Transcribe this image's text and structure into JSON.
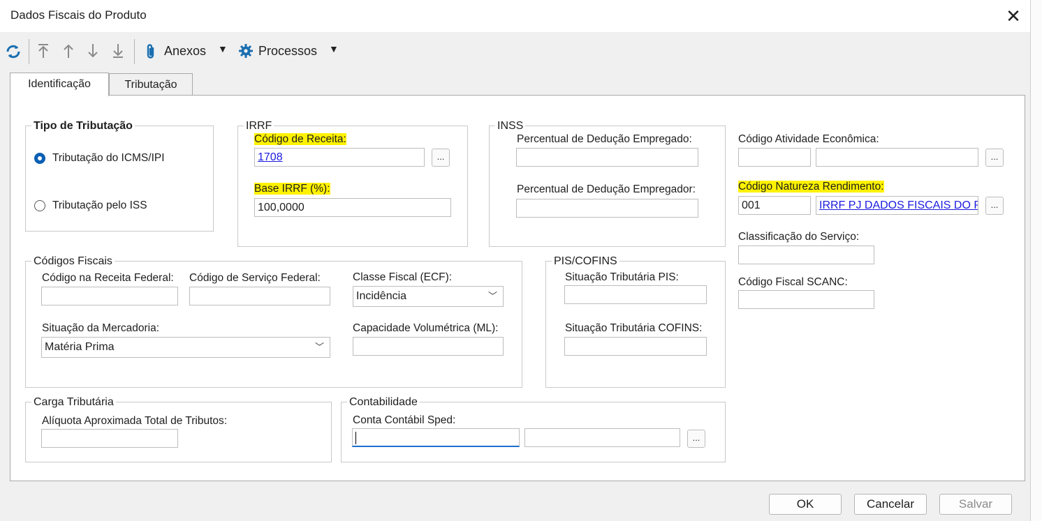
{
  "window": {
    "title": "Dados Fiscais do Produto",
    "close_glyph": "✕"
  },
  "toolbar": {
    "icons": [
      "refresh-icon",
      "move-first-icon",
      "move-up-icon",
      "move-down-icon",
      "move-last-icon"
    ],
    "anexos_label": "Anexos",
    "processos_label": "Processos"
  },
  "tabs": [
    {
      "label": "Identificação",
      "active": true
    },
    {
      "label": "Tributação",
      "active": false
    }
  ],
  "tipo_tributacao": {
    "title": "Tipo de Tributação",
    "options": [
      {
        "label": "Tributação do ICMS/IPI",
        "selected": true
      },
      {
        "label": "Tributação pelo ISS",
        "selected": false
      }
    ]
  },
  "irrf": {
    "title": "IRRF",
    "codigo_receita_label": "Código de Receita:",
    "codigo_receita_value": "1708",
    "base_label": "Base IRRF (%):",
    "base_value": "100,0000"
  },
  "inss": {
    "title": "INSS",
    "empregado_label": "Percentual de Dedução Empregado:",
    "empregado_value": "",
    "empregador_label": "Percentual de Dedução Empregador:",
    "empregador_value": ""
  },
  "right": {
    "atividade_label": "Código Atividade Econômica:",
    "atividade_code": "",
    "atividade_desc": "",
    "natureza_label": "Código Natureza Rendimento:",
    "natureza_code": "001",
    "natureza_desc": "IRRF PJ DADOS FISCAIS DO P",
    "classificacao_label": "Classificação do Serviço:",
    "classificacao_value": "",
    "scanc_label": "Código Fiscal SCANC:",
    "scanc_value": ""
  },
  "codigos_fiscais": {
    "title": "Códigos Fiscais",
    "receita_federal_label": "Código na Receita Federal:",
    "receita_federal_value": "",
    "servico_federal_label": "Código de Serviço Federal:",
    "servico_federal_value": "",
    "classe_fiscal_label": "Classe Fiscal (ECF):",
    "classe_fiscal_value": "Incidência",
    "situacao_label": "Situação da Mercadoria:",
    "situacao_value": "Matéria Prima",
    "capacidade_label": "Capacidade Volumétrica (ML):",
    "capacidade_value": ""
  },
  "pis_cofins": {
    "title": "PIS/COFINS",
    "pis_label": "Situação Tributária PIS:",
    "pis_value": "",
    "cofins_label": "Situação Tributária COFINS:",
    "cofins_value": ""
  },
  "carga": {
    "title": "Carga Tributária",
    "aliquota_label": "Alíquota Aproximada Total de Tributos:",
    "aliquota_value": ""
  },
  "contabilidade": {
    "title": "Contabilidade",
    "conta_label": "Conta Contábil Sped:",
    "conta_code": "",
    "conta_desc": ""
  },
  "buttons": {
    "ok": "OK",
    "cancelar": "Cancelar",
    "salvar": "Salvar"
  },
  "colors": {
    "highlight": "#fff200",
    "link": "#1a1ae0",
    "radio_selected": "#0a5fb4"
  }
}
